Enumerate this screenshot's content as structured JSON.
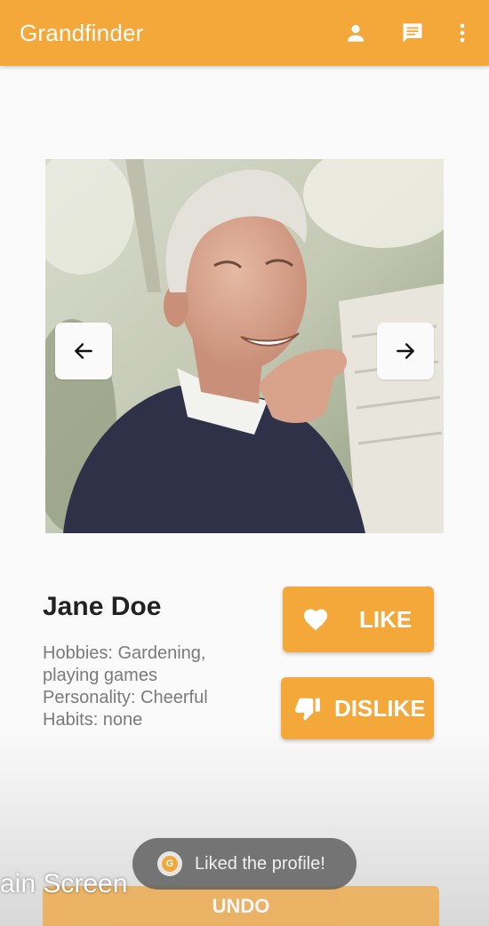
{
  "appbar": {
    "title": "Grandfinder",
    "icons": [
      "person-icon",
      "chat-icon",
      "more-vert-icon"
    ],
    "color": "#f5a83a"
  },
  "carousel": {
    "prev_icon": "arrow-left-icon",
    "next_icon": "arrow-right-icon"
  },
  "profile": {
    "name": "Jane Doe",
    "hobbies": "Hobbies: Gardening, playing games",
    "personality": "Personality: Cheerful",
    "habits": "Habits: none"
  },
  "actions": {
    "like_label": "LIKE",
    "like_icon": "heart-icon",
    "dislike_label": "DISLIKE",
    "dislike_icon": "thumb-down-icon",
    "undo_label": "UNDO"
  },
  "toast": {
    "badge": "G",
    "message": "Liked the profile!"
  },
  "overlay": {
    "caption": "ain Screen"
  }
}
